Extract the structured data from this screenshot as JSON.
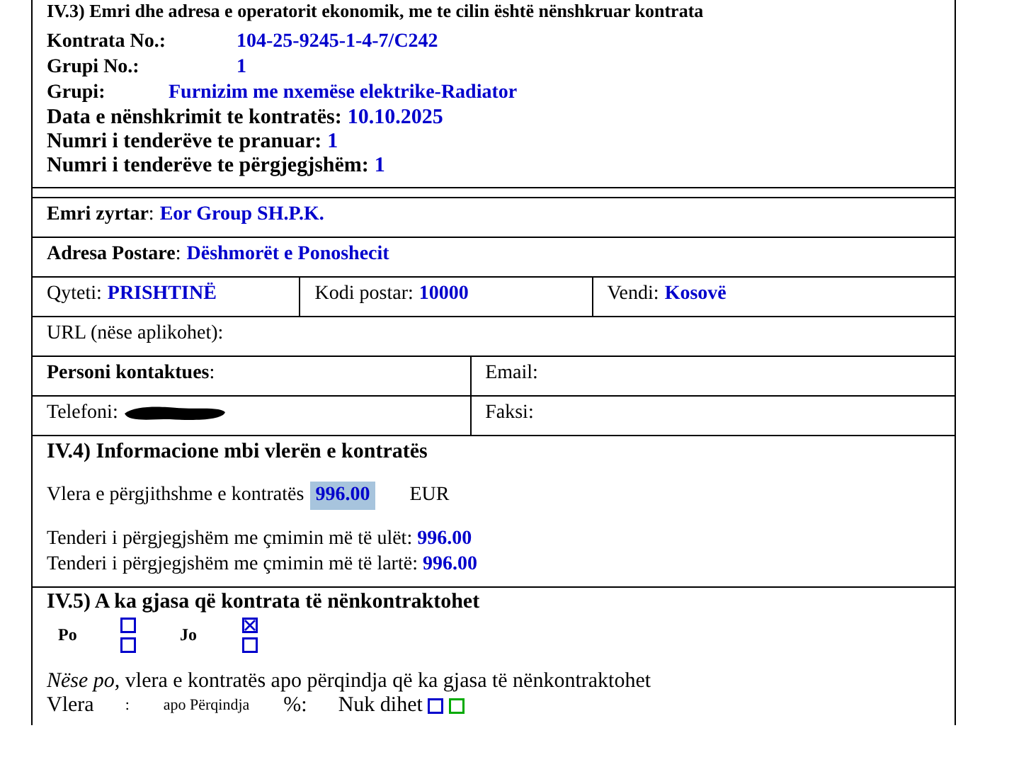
{
  "heading": "IV.3) Emri dhe adresa e operatorit ekonomik, me te cilin është nënshkruar kontrata",
  "contract_fields": [
    {
      "label": "Kontrata No.:",
      "value": "104-25-9245-1-4-7/C242",
      "kind": "wide"
    },
    {
      "label": "Grupi No.:",
      "value": "1",
      "kind": "wide"
    },
    {
      "label": "Grupi:",
      "value": "Furnizim me nxemëse elektrike-Radiator",
      "kind": "narrow"
    },
    {
      "label": "Data e nënshkrimit te kontratës:",
      "value": "10.10.2025",
      "kind": "inline"
    },
    {
      "label": "Numri i tenderëve te pranuar:",
      "value": "1",
      "kind": "inline"
    },
    {
      "label": "Numri i tenderëve te përgjegjshëm:",
      "value": "1",
      "kind": "inline"
    }
  ],
  "operator_rows": [
    [
      {
        "label": "Emri zyrtar",
        "colon": ":",
        "value": "Eor Group SH.P.K.",
        "strong": true
      }
    ],
    [
      {
        "label": "Adresa Postare",
        "colon": ":",
        "value": "Dëshmorët e Ponoshecit",
        "strong": true
      }
    ],
    [
      {
        "label": "Qyteti:",
        "value": "PRISHTINË",
        "strong": false
      },
      {
        "label": "Kodi postar:",
        "value": "10000",
        "strong": false
      },
      {
        "label": "Vendi:",
        "value": "Kosovë",
        "strong": false
      }
    ],
    [
      {
        "label": "URL (nëse aplikohet):",
        "strong": false
      }
    ],
    [
      {
        "label": "Personi kontaktues",
        "colon": ":",
        "strong": true
      },
      {
        "label": "Email:",
        "strong": false
      }
    ],
    [
      {
        "label": "Telefoni:",
        "strong": false,
        "redacted": true
      },
      {
        "label": "Faksi:",
        "strong": false
      }
    ]
  ],
  "value_section": {
    "title": "IV.4) Informacione mbi vlerën e kontratës",
    "total_label": "Vlera e përgjithshme e kontratës",
    "total_value": "996.00",
    "total_highlighted": true,
    "currency": "EUR",
    "lines": [
      {
        "label": "Tenderi i përgjegjshëm me çmimin më të ulët:",
        "value": "996.00"
      },
      {
        "label": "Tenderi i përgjegjshëm me çmimin më të lartë:",
        "value": "996.00"
      }
    ]
  },
  "subcontract": {
    "title": "IV.5) A ka gjasa që kontrata të nënkontraktohet",
    "options": [
      {
        "label": "Po",
        "boxes": [
          {
            "checked": false
          },
          {
            "checked": false
          }
        ]
      },
      {
        "label": "Jo",
        "boxes": [
          {
            "checked": true
          },
          {
            "checked": false
          }
        ]
      }
    ],
    "note": "*Nëse po,* vlera e kontratës apo përqindja që ka gjasa të nënkontraktohet",
    "bottom_texts": [
      {
        "text": "Vlera",
        "kind": "normal"
      },
      {
        "text": ":",
        "kind": "small"
      },
      {
        "text": "apo Përqindja",
        "kind": "small"
      },
      {
        "text": "%:",
        "kind": "normal"
      },
      {
        "text": "Nuk dihet",
        "kind": "normal"
      }
    ],
    "unknown_boxes": [
      {
        "checked": false,
        "color": "#0000cc"
      },
      {
        "checked": false,
        "color": "#00aa00"
      }
    ]
  }
}
